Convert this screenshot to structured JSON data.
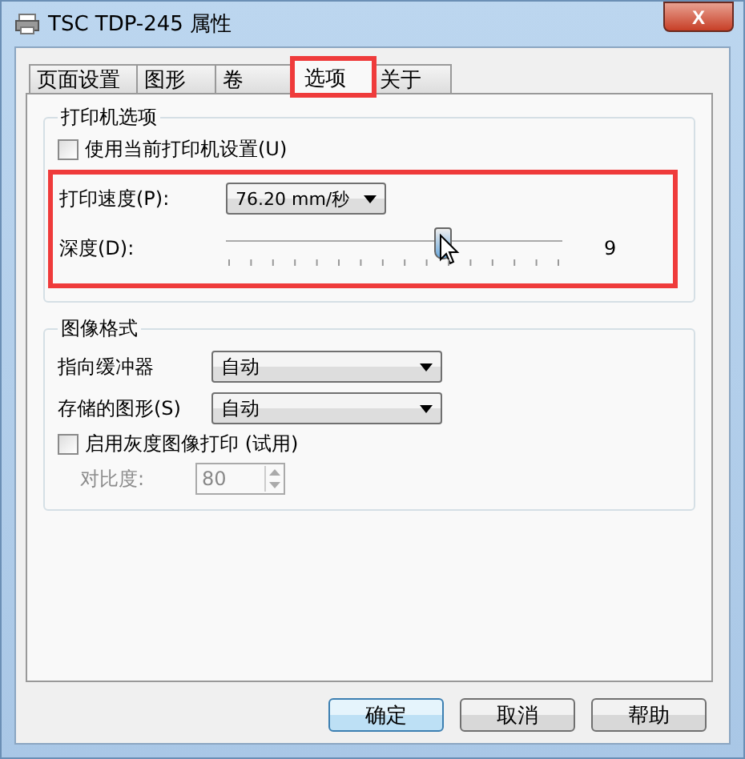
{
  "window": {
    "title": "TSC TDP-245 属性",
    "close": "X"
  },
  "tabs": [
    {
      "label": "页面设置",
      "selected": false,
      "highlighted": false
    },
    {
      "label": "图形",
      "selected": false,
      "highlighted": false
    },
    {
      "label": "卷",
      "selected": false,
      "highlighted": false
    },
    {
      "label": "选项",
      "selected": true,
      "highlighted": true
    },
    {
      "label": "关于",
      "selected": false,
      "highlighted": false
    }
  ],
  "printer_options": {
    "title": "打印机选项",
    "use_current": {
      "label": "使用当前打印机设置(U)",
      "checked": false
    },
    "highlighted": true,
    "speed": {
      "label": "打印速度(P):",
      "value": "76.20 mm/秒"
    },
    "darkness": {
      "label": "深度(D):",
      "level": 0.6,
      "reading": "9"
    }
  },
  "image_format": {
    "title": "图像格式",
    "dropdowns": [
      {
        "label": "指向缓冲器",
        "value": "自动"
      },
      {
        "label": "存储的图形(S)",
        "value": "自动"
      }
    ],
    "grayscale": {
      "label": "启用灰度图像打印 (试用)",
      "checked": false
    },
    "contrast": {
      "label": "对比度:",
      "value": "80",
      "disabled": true
    }
  },
  "buttons": [
    {
      "label": "确定",
      "default": true
    },
    {
      "label": "取消",
      "default": false
    },
    {
      "label": "帮助",
      "default": false
    }
  ]
}
